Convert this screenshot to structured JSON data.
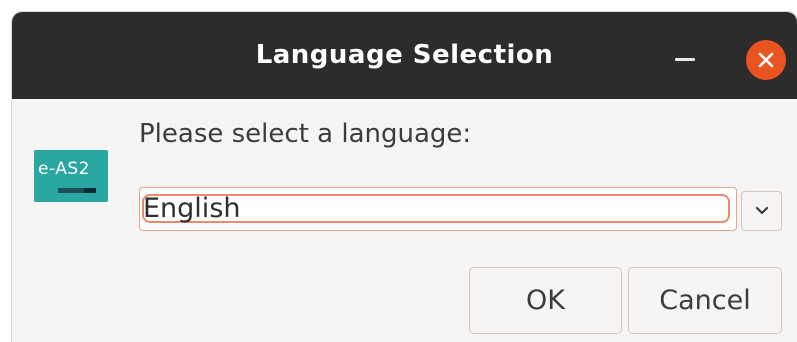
{
  "window": {
    "title": "Language Selection",
    "minimize_icon": "minimize-icon",
    "close_icon": "close-icon",
    "close_color": "#e95420"
  },
  "logo": {
    "text": "e-AS2",
    "color": "#2aa6a3"
  },
  "dialog": {
    "prompt": "Please select a language:",
    "language_select": {
      "selected": "English",
      "arrow_icon": "chevron-down-icon"
    },
    "ok_label": "OK",
    "cancel_label": "Cancel"
  }
}
